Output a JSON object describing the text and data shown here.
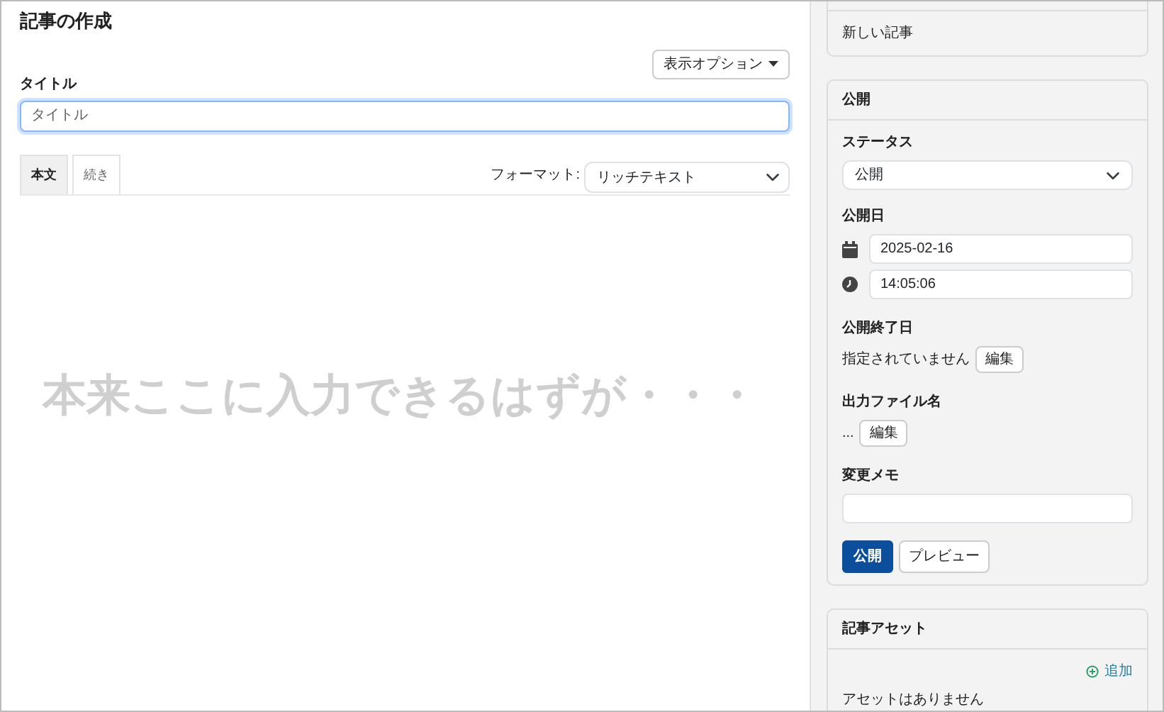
{
  "page_title": "記事の作成",
  "view_options_button": "表示オプション",
  "title_field": {
    "label": "タイトル",
    "placeholder": "タイトル",
    "focused": true
  },
  "editor_tabs": [
    {
      "label": "本文",
      "selected": true
    },
    {
      "label": "続き",
      "selected": false
    }
  ],
  "format": {
    "label": "フォーマット:",
    "value": "リッチテキスト"
  },
  "editor_overlay_text": "本来ここに入力できるはずが・・・",
  "sidebar": {
    "basename_card": {
      "text": "新しい記事"
    },
    "publish_card": {
      "title": "公開",
      "status_label": "ステータス",
      "status_value": "公開",
      "date_label": "公開日",
      "date": "2025-02-16",
      "time": "14:05:06",
      "end_label": "公開終了日",
      "end_text": "指定されていません",
      "end_edit": "編集",
      "file_label": "出力ファイル名",
      "file_text": "...",
      "file_edit": "編集",
      "memo_label": "変更メモ",
      "publish_button": "公開",
      "preview_button": "プレビュー"
    },
    "assets_card": {
      "title": "記事アセット",
      "add_link": "追加",
      "empty_text": "アセットはありません"
    }
  }
}
